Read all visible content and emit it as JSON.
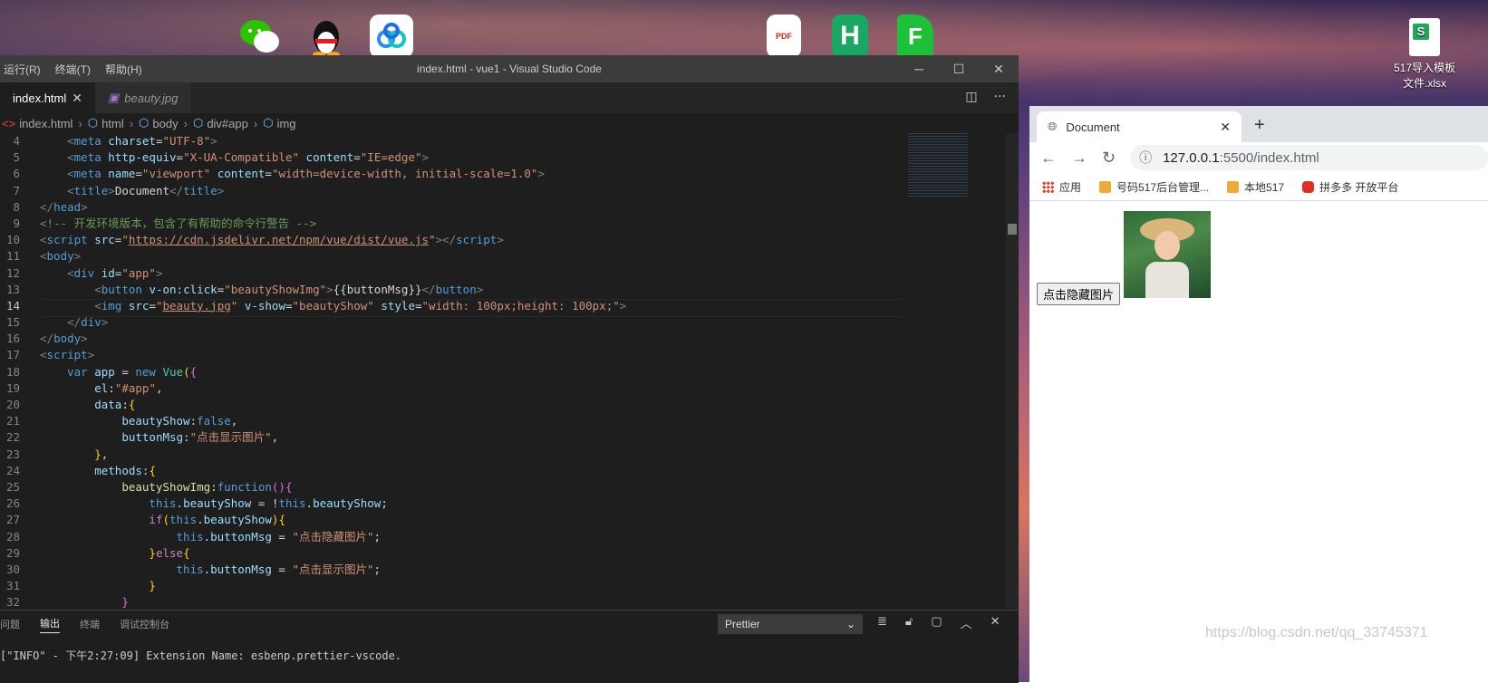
{
  "desktop": {
    "icons": [
      {
        "name": "wechat-icon",
        "label": ""
      },
      {
        "name": "qq-icon",
        "label": ""
      },
      {
        "name": "baidu-netdisk-icon",
        "label": ""
      },
      {
        "name": "pdf-icon",
        "label": "PDF"
      },
      {
        "name": "hbuilder-icon",
        "label": "H"
      },
      {
        "name": "f-app-icon",
        "label": "F"
      }
    ],
    "file_label_line1": "517导入模板",
    "file_label_line2": "文件.xlsx"
  },
  "vscode": {
    "menu": [
      "运行(R)",
      "终端(T)",
      "帮助(H)"
    ],
    "title": "index.html - vue1 - Visual Studio Code",
    "tabs": [
      {
        "label": "index.html",
        "active": true
      },
      {
        "label": "beauty.jpg",
        "active": false
      }
    ],
    "breadcrumb": [
      "index.html",
      "html",
      "body",
      "div#app",
      "img"
    ],
    "current_line": 14,
    "panel": {
      "tabs": [
        "问题",
        "输出",
        "终端",
        "调试控制台"
      ],
      "active_tab": "输出",
      "output_channel": "Prettier",
      "log_line": "[\"INFO\" - 下午2:27:09] Extension Name: esbenp.prettier-vscode."
    }
  },
  "browser": {
    "tab_title": "Document",
    "url_host": "127.0.0.1",
    "url_rest": ":5500/index.html",
    "bookmarks": [
      "应用",
      "号码517后台管理...",
      "本地517",
      "拼多多 开放平台"
    ],
    "button_label": "点击隐藏图片"
  },
  "watermark": "https://blog.csdn.net/qq_33745371"
}
